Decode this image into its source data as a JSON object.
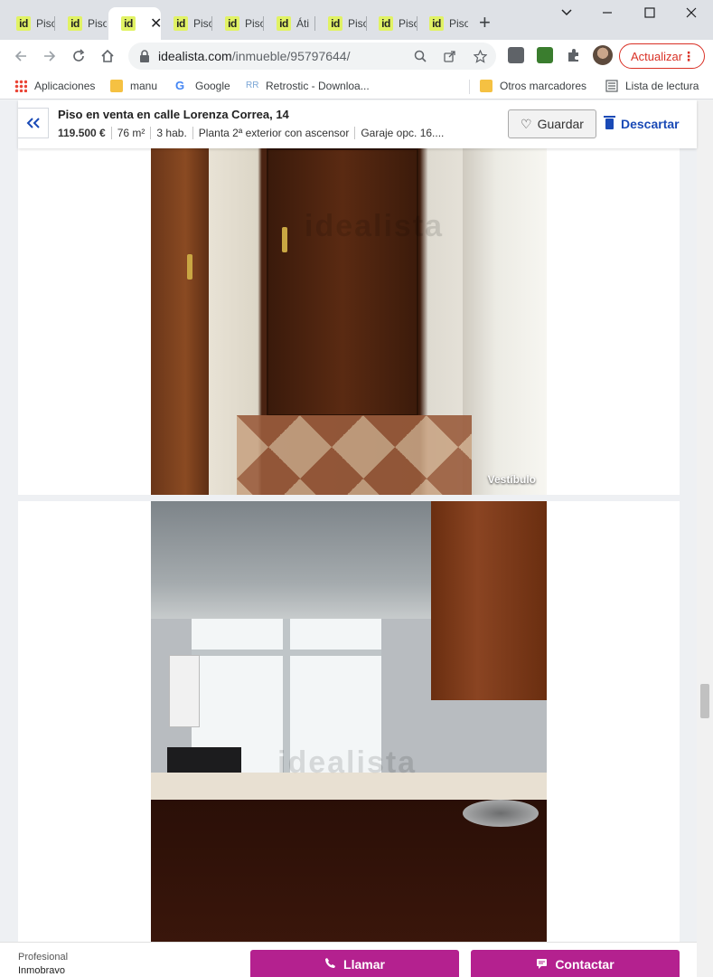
{
  "browser": {
    "tabs": [
      {
        "label": "Piso",
        "icon": "idealista-favicon"
      },
      {
        "label": "Piso",
        "icon": "idealista-favicon"
      },
      {
        "label": "",
        "icon": "idealista-favicon",
        "active": true
      },
      {
        "label": "Piso",
        "icon": "idealista-favicon"
      },
      {
        "label": "Piso",
        "icon": "idealista-favicon"
      },
      {
        "label": "Áti",
        "icon": "idealista-favicon"
      },
      {
        "label": "Piso",
        "icon": "idealista-favicon"
      },
      {
        "label": "Piso",
        "icon": "idealista-favicon"
      },
      {
        "label": "Piso",
        "icon": "idealista-favicon"
      }
    ],
    "favicon_text": "id",
    "new_tab": "+",
    "url_host": "idealista.com",
    "url_path": "/inmueble/95797644/",
    "update_button": "Actualizar",
    "accent": "#d93025"
  },
  "bookmarks": {
    "apps": "Aplicaciones",
    "manu": "manu",
    "google": "Google",
    "retrostic": "Retrostic - Downloa...",
    "otros": "Otros marcadores",
    "lista": "Lista de lectura"
  },
  "listing": {
    "title": "Piso en venta en calle Lorenza Correa, 14",
    "price": "119.500 €",
    "area": "76 m²",
    "rooms": "3 hab.",
    "floor": "Planta 2ª exterior con ascensor",
    "garage": "Garaje opc. 16....",
    "save_label": "Guardar",
    "discard_label": "Descartar",
    "brand_color": "#1a4ab6"
  },
  "photos": [
    {
      "label": "Vestíbulo",
      "watermark": "idealista"
    },
    {
      "label": "",
      "watermark": "idealista"
    }
  ],
  "contact_bar": {
    "agency_type": "Profesional",
    "agency_name": "Inmobravo",
    "call_label": "Llamar",
    "contact_label": "Contactar",
    "cta_color": "#b4218f"
  }
}
